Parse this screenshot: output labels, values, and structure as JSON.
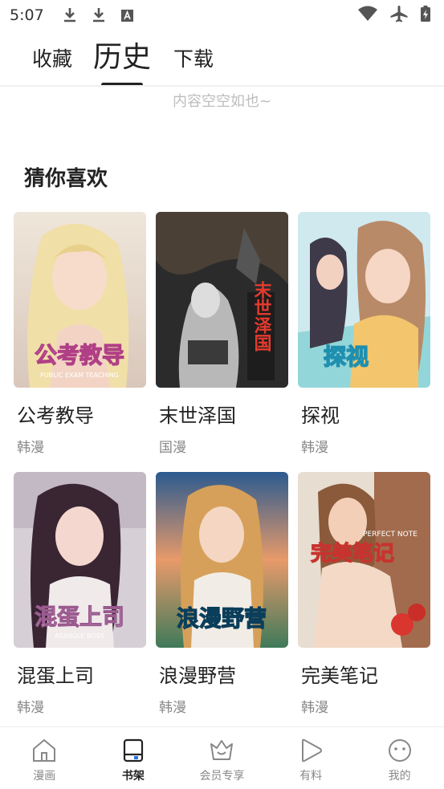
{
  "status_bar": {
    "time": "5:07",
    "left_icons": [
      "download-icon",
      "download-icon",
      "font-app-icon"
    ],
    "right_icons": [
      "wifi-icon",
      "airplane-icon",
      "battery-charging-icon"
    ]
  },
  "tabs": [
    {
      "label": "收藏",
      "active": false
    },
    {
      "label": "历史",
      "active": true
    },
    {
      "label": "下载",
      "active": false
    }
  ],
  "empty_text": "内容空空如也~",
  "section_title": "猜你喜欢",
  "comics": [
    {
      "title": "公考教导",
      "tag": "韩漫",
      "cover_text": "公考教导",
      "cover_subtext": "PUBLIC EXAM TEACHING"
    },
    {
      "title": "末世泽国",
      "tag": "国漫",
      "cover_text": "末世泽国",
      "cover_subtext": ""
    },
    {
      "title": "探视",
      "tag": "韩漫",
      "cover_text": "探视",
      "cover_subtext": ""
    },
    {
      "title": "混蛋上司",
      "tag": "韩漫",
      "cover_text": "混蛋上司",
      "cover_subtext": "ASSHOLE BOSS"
    },
    {
      "title": "浪漫野营",
      "tag": "韩漫",
      "cover_text": "浪漫野营",
      "cover_subtext": ""
    },
    {
      "title": "完美笔记",
      "tag": "韩漫",
      "cover_text": "完美笔记",
      "cover_subtext": "PERFECT NOTE"
    }
  ],
  "bottom_nav": [
    {
      "label": "漫画",
      "icon": "home-icon",
      "active": false
    },
    {
      "label": "书架",
      "icon": "bookshelf-icon",
      "active": true
    },
    {
      "label": "会员专享",
      "icon": "vip-crown-icon",
      "active": false
    },
    {
      "label": "有料",
      "icon": "play-icon",
      "active": false
    },
    {
      "label": "我的",
      "icon": "profile-face-icon",
      "active": false
    }
  ],
  "colors": {
    "accent": "#2a73e8",
    "text": "#222222",
    "muted": "#888888"
  }
}
